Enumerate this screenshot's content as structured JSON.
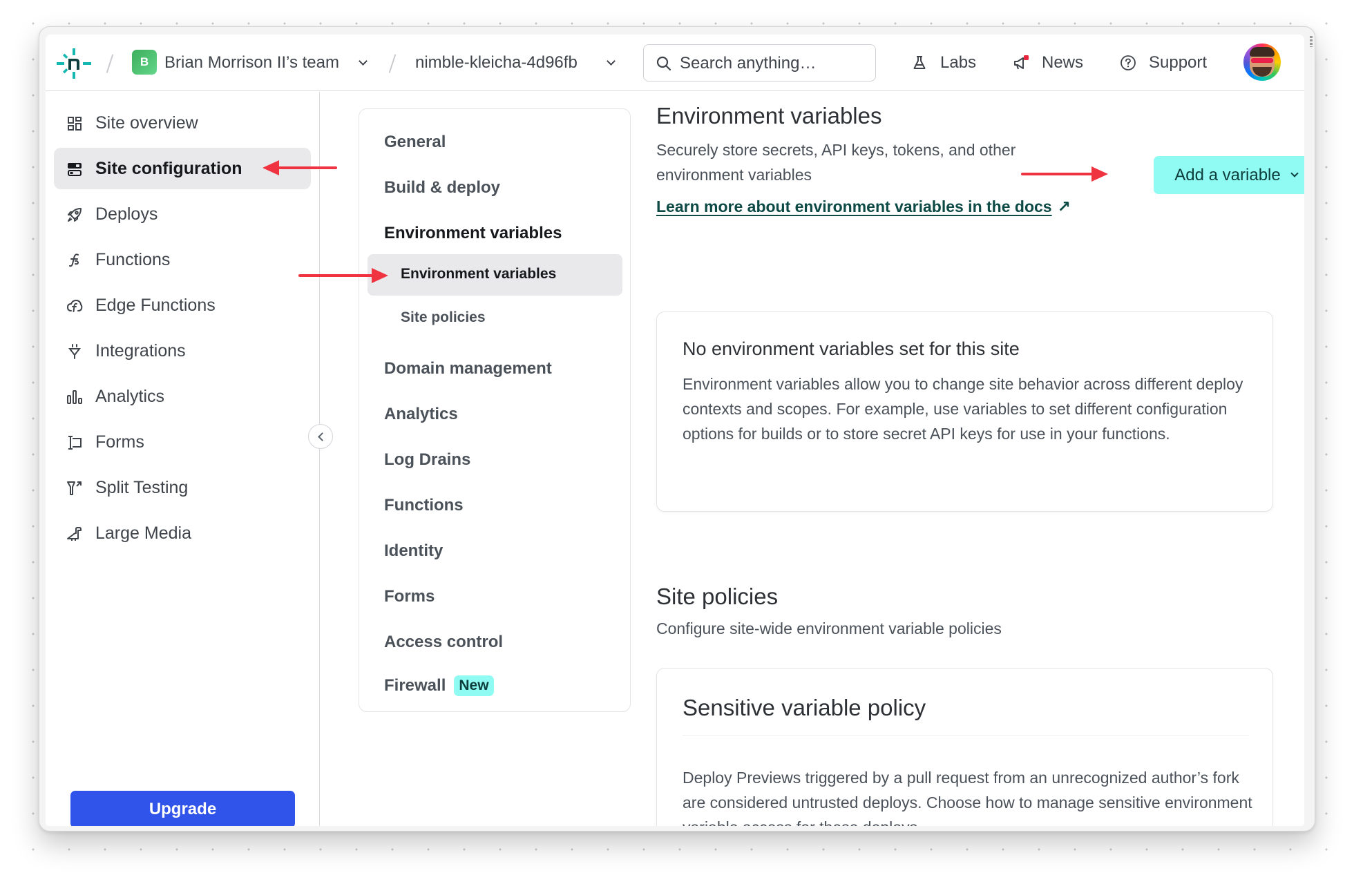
{
  "header": {
    "logo": "netlify-logo-icon",
    "team": {
      "initial": "B",
      "name": "Brian Morrison II’s team"
    },
    "site": {
      "name": "nimble-kleicha-4d96fb"
    },
    "search": {
      "placeholder": "Search anything…",
      "value": ""
    },
    "links": [
      {
        "label": "Labs",
        "icon": "flask-icon"
      },
      {
        "label": "News",
        "icon": "megaphone-icon",
        "has_notification": true
      },
      {
        "label": "Support",
        "icon": "help-circle-icon"
      }
    ],
    "avatar": "user-avatar"
  },
  "sidebar": {
    "items": [
      {
        "label": "Site overview",
        "icon": "grid-icon",
        "active": false
      },
      {
        "label": "Site configuration",
        "icon": "toggles-icon",
        "active": true
      },
      {
        "label": "Deploys",
        "icon": "rocket-icon",
        "active": false
      },
      {
        "label": "Functions",
        "icon": "function-icon",
        "active": false
      },
      {
        "label": "Edge Functions",
        "icon": "cloud-function-icon",
        "active": false
      },
      {
        "label": "Integrations",
        "icon": "plug-icon",
        "active": false
      },
      {
        "label": "Analytics",
        "icon": "bar-chart-icon",
        "active": false
      },
      {
        "label": "Forms",
        "icon": "form-icon",
        "active": false
      },
      {
        "label": "Split Testing",
        "icon": "split-icon",
        "active": false
      },
      {
        "label": "Large Media",
        "icon": "dinosaur-icon",
        "active": false
      }
    ],
    "upgrade_label": "Upgrade"
  },
  "subnav": {
    "items": [
      {
        "label": "General"
      },
      {
        "label": "Build & deploy"
      },
      {
        "label": "Environment variables",
        "section_active": true,
        "children": [
          {
            "label": "Environment variables",
            "active": true
          },
          {
            "label": "Site policies",
            "active": false
          }
        ]
      },
      {
        "label": "Domain management"
      },
      {
        "label": "Analytics"
      },
      {
        "label": "Log Drains"
      },
      {
        "label": "Functions"
      },
      {
        "label": "Identity"
      },
      {
        "label": "Forms"
      },
      {
        "label": "Access control"
      },
      {
        "label": "Firewall",
        "badge": "New"
      }
    ]
  },
  "main": {
    "env": {
      "title": "Environment variables",
      "description": "Securely store secrets, API keys, tokens, and other environment variables",
      "docs_link": "Learn more about environment variables in the docs",
      "docs_link_icon": "↗",
      "add_button": "Add a variable",
      "empty_title": "No environment variables set for this site",
      "empty_body": "Environment variables allow you to change site behavior across different deploy contexts and scopes. For example, use variables to set different configuration options for builds or to store secret API keys for use in your functions."
    },
    "policies": {
      "title": "Site policies",
      "description": "Configure site-wide environment variable policies",
      "card_title": "Sensitive variable policy",
      "card_body": "Deploy Previews triggered by a pull request from an unrecognized author’s fork are considered untrusted deploys. Choose how to manage sensitive environment variable access for these deploys."
    }
  },
  "colors": {
    "accent_teal": "#8ffbf2",
    "accent_teal_text": "#0d3d3d",
    "upgrade_blue": "#3053ea",
    "annotation_red": "#ef3340",
    "link_green": "#0d4a45"
  }
}
